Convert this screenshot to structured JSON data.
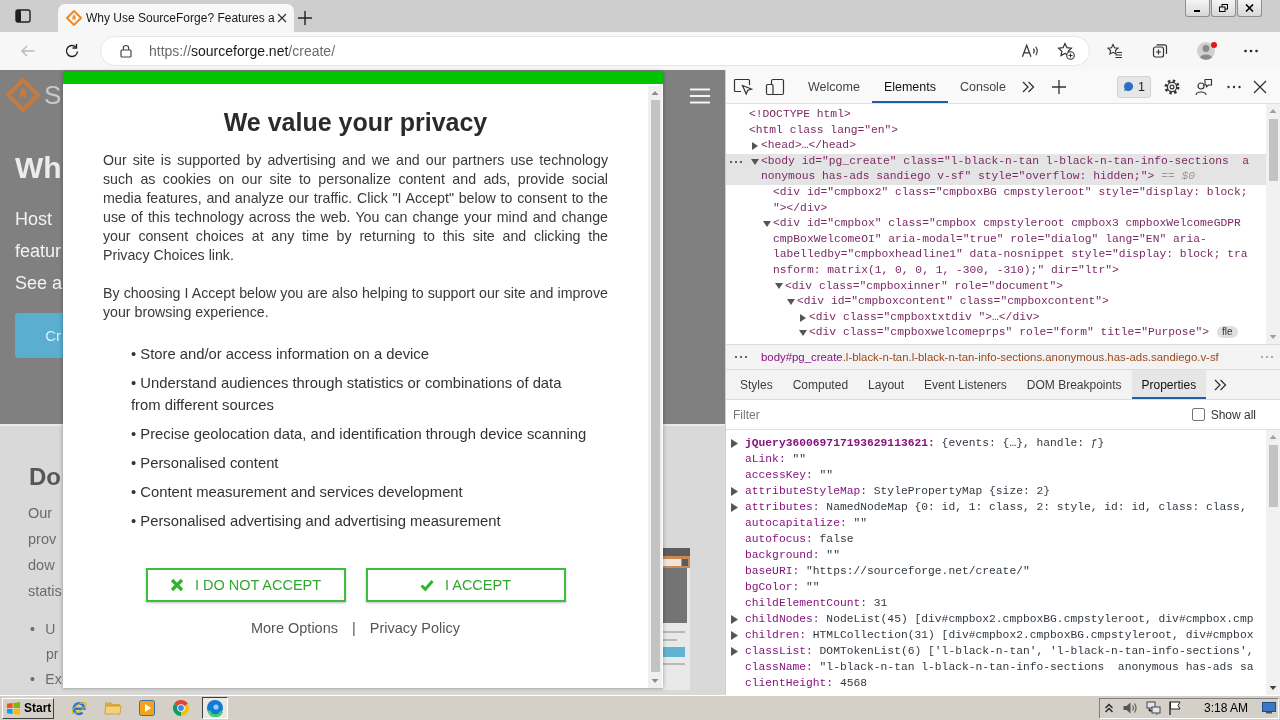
{
  "browser": {
    "tabs": [
      {
        "title": "Why Use SourceForge? Features a",
        "selected": true
      }
    ],
    "url": {
      "scheme": "https://",
      "host": "sourceforge.net",
      "path": "/create/"
    }
  },
  "page": {
    "logo_text": "S",
    "hero": {
      "heading": "Wh",
      "text_lines": [
        "Host",
        "featur",
        "See a"
      ],
      "button": "Cr"
    },
    "section": {
      "heading": "Do",
      "text_lines": [
        "Our",
        "prov",
        "dow",
        "statis"
      ],
      "list_items": [
        {
          "lines": [
            "• U",
            "pr"
          ]
        },
        {
          "lines": [
            "• Ex"
          ]
        }
      ]
    }
  },
  "consent_dialog": {
    "title": "We value your privacy",
    "paragraphs": [
      "Our site is supported by advertising and we and our partners use technology such as cookies on our site to personalize content and ads, provide social media features, and analyze our traffic. Click \"I Accept\" below to consent to the use of this technology across the web. You can change your mind and change your consent choices at any time by returning to this site and clicking the Privacy Choices link.",
      "By choosing I Accept below you are also helping to support our site and improve your browsing experience."
    ],
    "purposes": [
      "• Store and/or access information on a device",
      "• Understand audiences through statistics or combinations of data from different sources",
      "• Precise geolocation data, and identification through device scanning",
      "• Personalised content",
      "• Content measurement and services development",
      "• Personalised advertising and advertising measurement"
    ],
    "buttons": [
      {
        "kind": "reject",
        "label": "I DO NOT ACCEPT"
      },
      {
        "kind": "accept",
        "label": "I ACCEPT"
      }
    ],
    "links": [
      "More Options",
      "Privacy Policy"
    ],
    "separator": "|"
  },
  "devtools": {
    "tabs": [
      {
        "label": "Welcome",
        "selected": false
      },
      {
        "label": "Elements",
        "selected": true
      },
      {
        "label": "Console",
        "selected": false
      }
    ],
    "issues": "1",
    "dom_tree": [
      {
        "lines": [
          "<!DOCTYPE html>"
        ],
        "selected": false
      },
      {
        "lines": [
          "<html class lang=\"en\">"
        ],
        "selected": false,
        "children": [
          {
            "lines": [
              "<head>…</head>"
            ],
            "expanded": false,
            "selected": false
          },
          {
            "lines": [
              "<body id=\"pg_create\" class=\"l-black-n-tan l-black-n-tan-info-sections  a",
              "nonymous has-ads sandiego v-sf\" style=\"overflow: hidden;\">"
            ],
            "suffix": "== $0",
            "expanded": true,
            "selected": true,
            "children": [
              {
                "lines": [
                  "<div id=\"cmpbox2\" class=\"cmpboxBG cmpstyleroot\" style=\"display: block;",
                  "\"></div>"
                ],
                "selected": false
              },
              {
                "lines": [
                  "<div id=\"cmpbox\" class=\"cmpbox cmpstyleroot cmpbox3 cmpboxWelcomeGDPR",
                  "cmpBoxWelcomeOI\" aria-modal=\"true\" role=\"dialog\" lang=\"EN\" aria-",
                  "labelledby=\"cmpboxheadline1\" data-nosnippet style=\"display: block; tra",
                  "nsform: matrix(1, 0, 0, 1, -300, -310);\" dir=\"ltr\">"
                ],
                "expanded": true,
                "selected": false,
                "children": [
                  {
                    "lines": [
                      "<div class=\"cmpboxinner\" role=\"document\">"
                    ],
                    "expanded": true,
                    "selected": false,
                    "children": [
                      {
                        "lines": [
                          "<div id=\"cmpboxcontent\" class=\"cmpboxcontent\">"
                        ],
                        "expanded": true,
                        "selected": false,
                        "children": [
                          {
                            "lines": [
                              "<div class=\"cmpboxtxtdiv \">…</div>"
                            ],
                            "expanded": false,
                            "selected": false
                          },
                          {
                            "lines": [
                              "<div class=\"cmpboxwelcomeprps\" role=\"form\" title=\"Purpose\">"
                            ],
                            "badge": "fle",
                            "expanded": true,
                            "selected": false
                          }
                        ]
                      }
                    ]
                  }
                ]
              }
            ]
          }
        ]
      }
    ],
    "breadcrumb": {
      "node": "body#pg_create",
      "classes": ".l-black-n-tan.l-black-n-tan-info-sections.anonymous.has-ads.sandiego.v-sf"
    },
    "panel_tabs": [
      {
        "label": "Styles",
        "selected": false
      },
      {
        "label": "Computed",
        "selected": false
      },
      {
        "label": "Layout",
        "selected": false
      },
      {
        "label": "Event Listeners",
        "selected": false
      },
      {
        "label": "DOM Breakpoints",
        "selected": false
      },
      {
        "label": "Properties",
        "selected": true
      }
    ],
    "filter": {
      "placeholder": "Filter"
    },
    "show_all": {
      "label": "Show all",
      "checked": false
    },
    "properties": [
      {
        "key": "jQuery360069717193629113621:",
        "value": "{events: {…}, handle: ƒ}",
        "expanded": false,
        "own": true
      },
      {
        "key": "aLink:",
        "value": "\"\"",
        "own": false
      },
      {
        "key": "accessKey:",
        "value": "\"\"",
        "own": false
      },
      {
        "key": "attributeStyleMap:",
        "value": "StylePropertyMap {size: 2}",
        "expanded": false,
        "own": false
      },
      {
        "key": "attributes:",
        "value": "NamedNodeMap {0: id, 1: class, 2: style, id: id, class: class,",
        "expanded": false,
        "own": false
      },
      {
        "key": "autocapitalize:",
        "value": "\"\"",
        "own": false
      },
      {
        "key": "autofocus:",
        "value": "false",
        "own": false
      },
      {
        "key": "background:",
        "value": "\"\"",
        "own": false
      },
      {
        "key": "baseURI:",
        "value": "\"https://sourceforge.net/create/\"",
        "own": false
      },
      {
        "key": "bgColor:",
        "value": "\"\"",
        "own": false
      },
      {
        "key": "childElementCount:",
        "value": "31",
        "own": false
      },
      {
        "key": "childNodes:",
        "value": "NodeList(45) [div#cmpbox2.cmpboxBG.cmpstyleroot, div#cmpbox.cmp",
        "expanded": false,
        "own": false
      },
      {
        "key": "children:",
        "value": "HTMLCollection(31) [div#cmpbox2.cmpboxBG.cmpstyleroot, div#cmpbox",
        "expanded": false,
        "own": false
      },
      {
        "key": "classList:",
        "value": "DOMTokenList(6) ['l-black-n-tan', 'l-black-n-tan-info-sections',",
        "expanded": false,
        "own": false
      },
      {
        "key": "className:",
        "value": "\"l-black-n-tan l-black-n-tan-info-sections  anonymous has-ads sa",
        "own": false
      },
      {
        "key": "clientHeight:",
        "value": "4568",
        "own": false
      }
    ]
  },
  "taskbar": {
    "start": "Start",
    "apps": [
      {
        "kind": "ie",
        "selected": false
      },
      {
        "kind": "folder",
        "selected": false
      },
      {
        "kind": "media",
        "selected": false
      },
      {
        "kind": "chrome",
        "selected": false
      },
      {
        "kind": "edge",
        "selected": true
      }
    ],
    "clock": "3:18 AM"
  }
}
